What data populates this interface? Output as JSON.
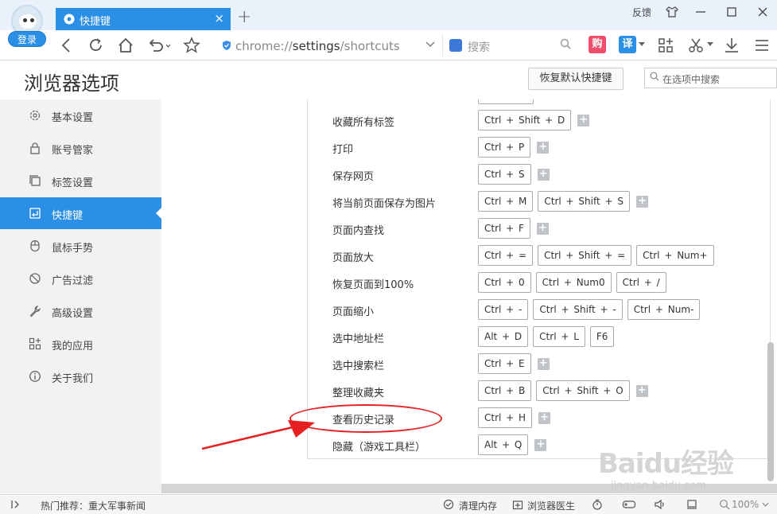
{
  "titlebar": {
    "login_label": "登录",
    "tab_label": "快捷键",
    "tab_close": "×",
    "new_tab": "+",
    "feedback": "反馈"
  },
  "addressbar": {
    "url_scheme": "chrome://",
    "url_host": "settings",
    "url_path": "/shortcuts",
    "search_placeholder": "搜索",
    "badge_gou": "购",
    "badge_yi": "译"
  },
  "page": {
    "title": "浏览器选项",
    "restore_button": "恢复默认快捷键",
    "search_placeholder": "在选项中搜索"
  },
  "sidebar": {
    "items": [
      {
        "label": "基本设置",
        "icon": "gear-icon"
      },
      {
        "label": "账号管家",
        "icon": "lock-icon"
      },
      {
        "label": "标签设置",
        "icon": "tabs-icon"
      },
      {
        "label": "快捷键",
        "icon": "shortcut-icon",
        "active": true
      },
      {
        "label": "鼠标手势",
        "icon": "mouse-icon"
      },
      {
        "label": "广告过滤",
        "icon": "block-icon"
      },
      {
        "label": "高级设置",
        "icon": "wrench-icon"
      },
      {
        "label": "我的应用",
        "icon": "apps-icon"
      },
      {
        "label": "关于我们",
        "icon": "info-icon"
      }
    ]
  },
  "shortcuts": {
    "rows": [
      {
        "label": "收藏所有标签",
        "keys": [
          "Ctrl + Shift + D"
        ],
        "addable": true
      },
      {
        "label": "打印",
        "keys": [
          "Ctrl + P"
        ],
        "addable": true
      },
      {
        "label": "保存网页",
        "keys": [
          "Ctrl + S"
        ],
        "addable": true
      },
      {
        "label": "将当前页面保存为图片",
        "keys": [
          "Ctrl + M",
          "Ctrl + Shift + S"
        ],
        "addable": true
      },
      {
        "label": "页面内查找",
        "keys": [
          "Ctrl + F"
        ],
        "addable": true
      },
      {
        "label": "页面放大",
        "keys": [
          "Ctrl + =",
          "Ctrl + Shift + =",
          "Ctrl + Num+"
        ],
        "addable": false
      },
      {
        "label": "恢复页面到100%",
        "keys": [
          "Ctrl + 0",
          "Ctrl + Num0",
          "Ctrl + /"
        ],
        "addable": false
      },
      {
        "label": "页面缩小",
        "keys": [
          "Ctrl + -",
          "Ctrl + Shift + -",
          "Ctrl + Num-"
        ],
        "addable": false
      },
      {
        "label": "选中地址栏",
        "keys": [
          "Alt + D",
          "Ctrl + L",
          "F6"
        ],
        "addable": false
      },
      {
        "label": "选中搜索栏",
        "keys": [
          "Ctrl + E"
        ],
        "addable": true
      },
      {
        "label": "整理收藏夹",
        "keys": [
          "Ctrl + B",
          "Ctrl + Shift + O"
        ],
        "addable": true
      },
      {
        "label": "查看历史记录",
        "keys": [
          "Ctrl + H"
        ],
        "addable": true
      },
      {
        "label": "隐藏（游戏工具栏）",
        "keys": [
          "Alt + Q"
        ],
        "addable": true
      }
    ],
    "add_symbol": "+"
  },
  "watermark": {
    "brand": "Baidu经验",
    "url": "jingyan.baidu.com"
  },
  "statusbar": {
    "hot_news": "热门推荐：重大军事新闻",
    "clean_memory": "清理内存",
    "browser_doctor": "浏览器医生",
    "zoom": "100%"
  },
  "colors": {
    "accent": "#2b8fe6",
    "annotation_red": "#e62020"
  }
}
